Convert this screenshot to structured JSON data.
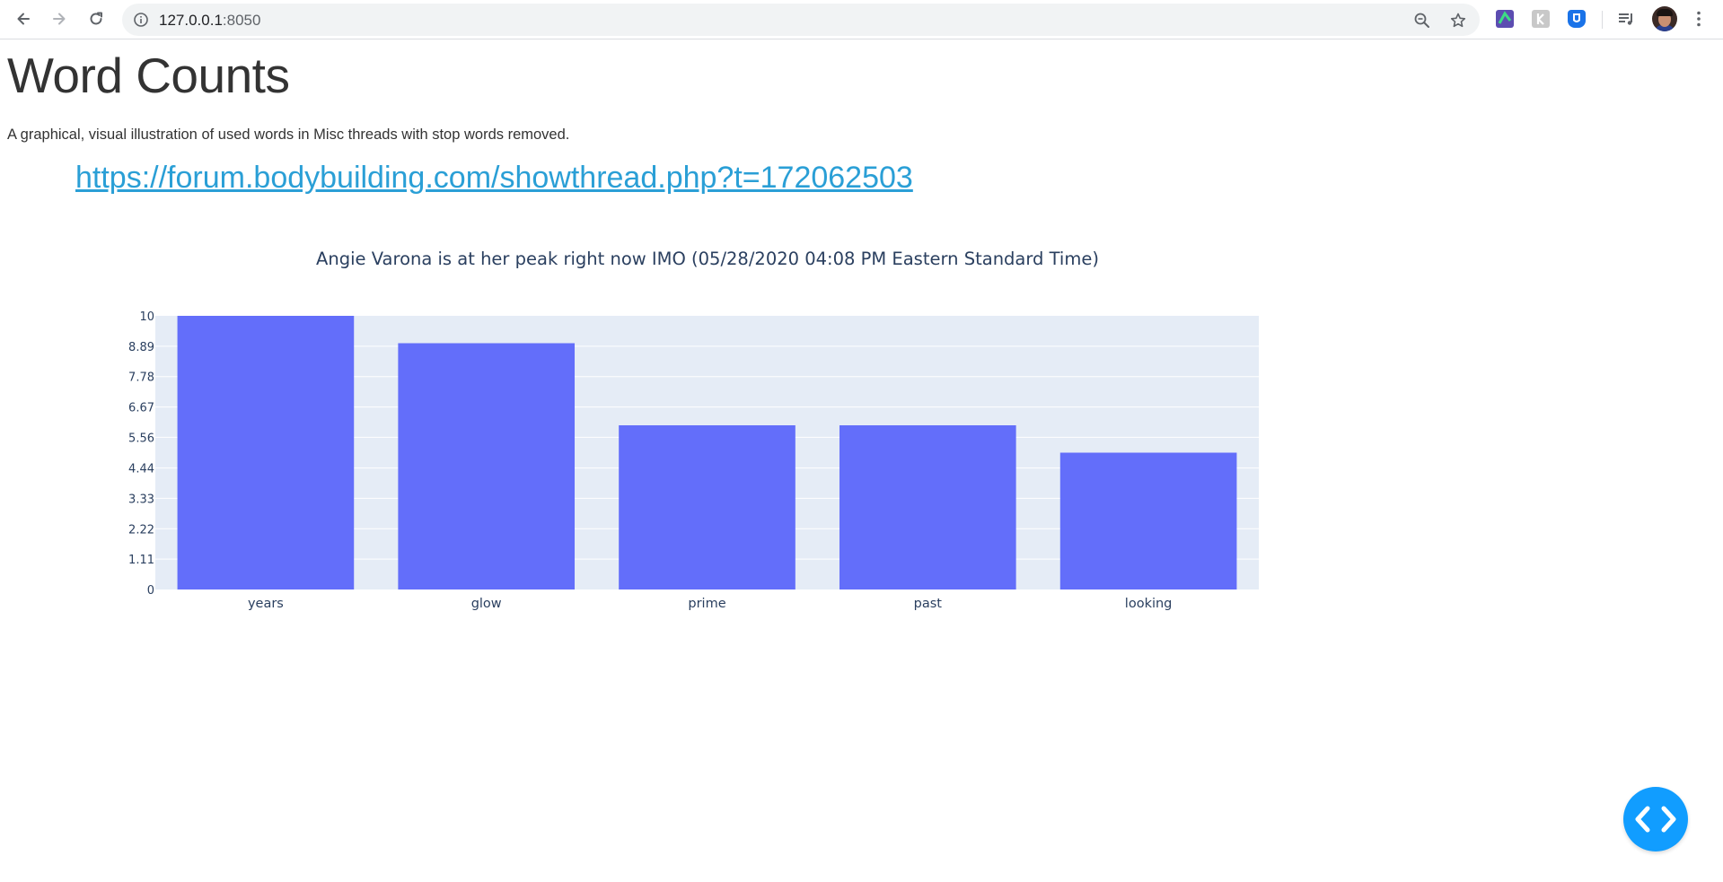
{
  "browser": {
    "url_host": "127.0.0.1",
    "url_port": ":8050"
  },
  "page": {
    "title": "Word Counts",
    "description": "A graphical, visual illustration of used words in Misc threads with stop words removed.",
    "link_text": "https://forum.bodybuilding.com/showthread.php?t=172062503"
  },
  "colors": {
    "bar": "#636efa",
    "plot_bg": "#e5ecf6",
    "link": "#2a9fd6",
    "debug_button": "#119dff"
  },
  "chart_data": {
    "type": "bar",
    "title": "Angie Varona is at her peak right now IMO (05/28/2020 04:08 PM Eastern Standard Time)",
    "categories": [
      "years",
      "glow",
      "prime",
      "past",
      "looking"
    ],
    "values": [
      10,
      9,
      6,
      6,
      5
    ],
    "ylim": [
      0,
      10
    ],
    "yticks": [
      "0",
      "1.11",
      "2.22",
      "3.33",
      "4.44",
      "5.56",
      "6.67",
      "7.78",
      "8.89",
      "10"
    ],
    "xlabel": "",
    "ylabel": "",
    "grid": true
  }
}
